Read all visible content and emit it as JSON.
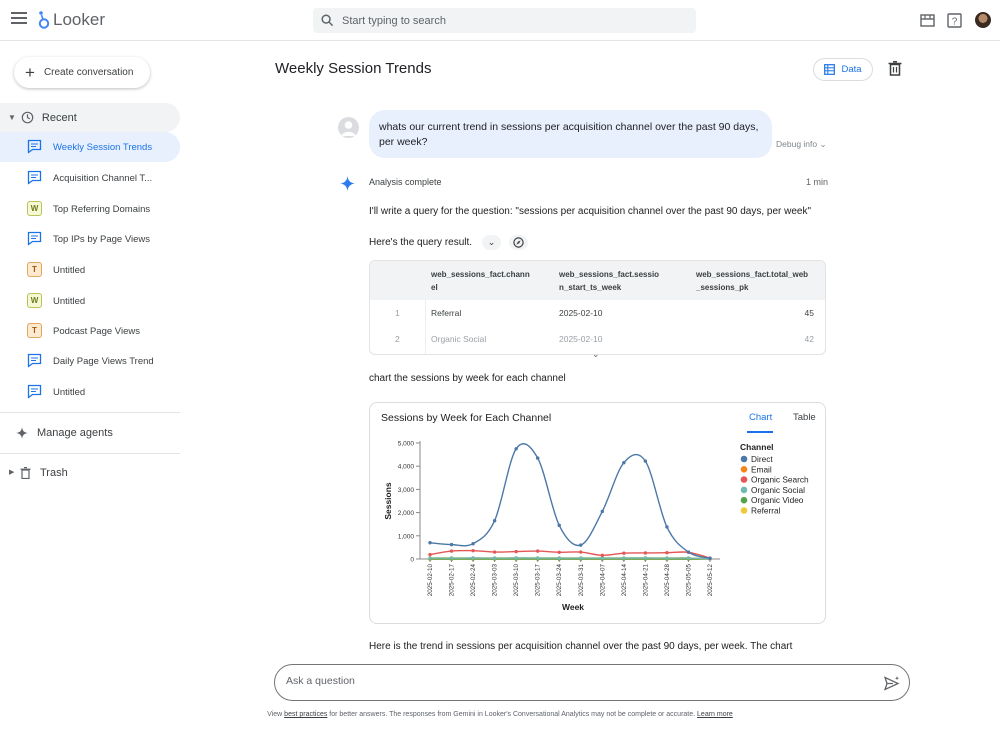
{
  "app": {
    "name": "Looker"
  },
  "search": {
    "placeholder": "Start typing to search"
  },
  "sidebar": {
    "create_label": "Create conversation",
    "recent_label": "Recent",
    "items": [
      {
        "label": "Weekly Session Trends",
        "chip": "conversation",
        "active": true
      },
      {
        "label": "Acquisition Channel T...",
        "chip": "conversation"
      },
      {
        "label": "Top Referring Domains",
        "chip": "W"
      },
      {
        "label": "Top IPs by Page Views",
        "chip": "conversation"
      },
      {
        "label": "Untitled",
        "chip": "T"
      },
      {
        "label": "Untitled",
        "chip": "W"
      },
      {
        "label": "Podcast Page Views",
        "chip": "T"
      },
      {
        "label": "Daily Page Views Trend",
        "chip": "conversation"
      },
      {
        "label": "Untitled",
        "chip": "conversation"
      }
    ],
    "manage_agents": "Manage agents",
    "trash": "Trash"
  },
  "header": {
    "title": "Weekly Session Trends",
    "data_button": "Data"
  },
  "conversation": {
    "question_line1": "whats our current trend in sessions per acquisition channel over the past 90 days,",
    "question_line2": "per week?",
    "debug": "Debug info",
    "status": "Analysis complete",
    "duration": "1 min",
    "intro": "I'll write a query for the question: \"sessions per acquisition channel over the past 90 days, per week\"",
    "query_result": "Here's the query result.",
    "chart_request": "chart the sessions by week for each channel",
    "summary": "Here is the trend in sessions per acquisition channel over the past 90 days, per week. The chart"
  },
  "query_table": {
    "columns": [
      {
        "l1": "web_sessions_fact.chann",
        "l2": "el"
      },
      {
        "l1": "web_sessions_fact.sessio",
        "l2": "n_start_ts_week"
      },
      {
        "l1": "web_sessions_fact.total_web",
        "l2": "_sessions_pk"
      }
    ],
    "rows": [
      {
        "n": "1",
        "channel": "Referral",
        "week": "2025-02-10",
        "value": "45"
      },
      {
        "n": "2",
        "channel": "Organic Social",
        "week": "2025-02-10",
        "value": "42"
      }
    ]
  },
  "chart_card": {
    "title": "Sessions by Week for Each Channel",
    "tab_chart": "Chart",
    "tab_table": "Table"
  },
  "chart_data": {
    "type": "line",
    "title": "Sessions by Week for Each Channel",
    "xlabel": "Week",
    "ylabel": "Sessions",
    "ylim": [
      0,
      5000
    ],
    "yticks": [
      "0",
      "1,000",
      "2,000",
      "3,000",
      "4,000",
      "5,000"
    ],
    "yticks_values": [
      0,
      1000,
      2000,
      3000,
      4000,
      5000
    ],
    "x": [
      "2025-02-10",
      "2025-02-17",
      "2025-02-24",
      "2025-03-03",
      "2025-03-10",
      "2025-03-17",
      "2025-03-24",
      "2025-03-31",
      "2025-04-07",
      "2025-04-14",
      "2025-04-21",
      "2025-04-28",
      "2025-05-05",
      "2025-05-12"
    ],
    "legend_title": "Channel",
    "legend_position": "right",
    "series": [
      {
        "name": "Direct",
        "color": "#4c78a8",
        "values": [
          700,
          620,
          660,
          1650,
          4750,
          4350,
          1450,
          600,
          2050,
          4150,
          4220,
          1380,
          300,
          30
        ]
      },
      {
        "name": "Email",
        "color": "#f58518",
        "values": [
          0,
          0,
          0,
          0,
          0,
          0,
          0,
          0,
          0,
          0,
          0,
          0,
          0,
          0
        ]
      },
      {
        "name": "Organic Search",
        "color": "#e45756",
        "values": [
          190,
          340,
          360,
          300,
          320,
          340,
          290,
          300,
          160,
          250,
          260,
          270,
          290,
          40
        ]
      },
      {
        "name": "Organic Social",
        "color": "#72b7b2",
        "values": [
          42,
          40,
          45,
          40,
          45,
          42,
          40,
          40,
          38,
          42,
          44,
          40,
          42,
          5
        ]
      },
      {
        "name": "Organic Video",
        "color": "#54a24b",
        "values": [
          0,
          0,
          0,
          0,
          0,
          0,
          0,
          0,
          0,
          0,
          0,
          0,
          0,
          0
        ]
      },
      {
        "name": "Referral",
        "color": "#eeca3b",
        "values": [
          45,
          46,
          44,
          45,
          47,
          45,
          44,
          46,
          45,
          44,
          46,
          45,
          44,
          5
        ]
      }
    ]
  },
  "composer": {
    "placeholder": "Ask a question"
  },
  "footer": {
    "before": "View ",
    "link1": "best practices",
    "middle": " for better answers. The responses from Gemini in Looker's Conversational Analytics may not be complete or accurate. ",
    "link2": "Learn more"
  }
}
